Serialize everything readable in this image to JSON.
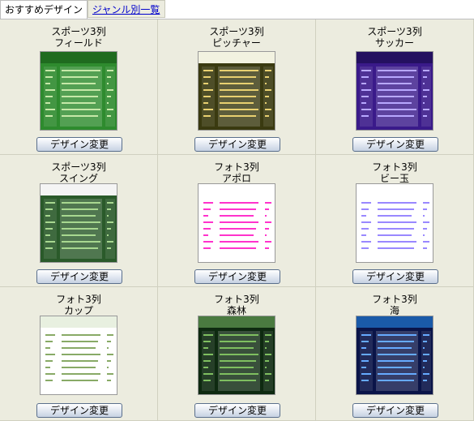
{
  "tabs": [
    {
      "label": "おすすめデザイン",
      "active": true
    },
    {
      "label": "ジャンル別一覧",
      "active": false
    }
  ],
  "button_label": "デザイン変更",
  "designs": [
    {
      "category": "スポーツ3列",
      "name": "フィールド",
      "theme": {
        "bg": "#2e8b2e",
        "header": "#1f6b1f",
        "accent": "#c6e8a8"
      }
    },
    {
      "category": "スポーツ3列",
      "name": "ピッチャー",
      "theme": {
        "bg": "#3a3a10",
        "header": "#f2f2e0",
        "accent": "#e8d070"
      }
    },
    {
      "category": "スポーツ3列",
      "name": "サッカー",
      "theme": {
        "bg": "#3a1a8a",
        "header": "#241060",
        "accent": "#b8a8ff"
      }
    },
    {
      "category": "スポーツ3列",
      "name": "スイング",
      "theme": {
        "bg": "#2a5a2a",
        "header": "#f4f4f4",
        "accent": "#a8d890"
      }
    },
    {
      "category": "フォト3列",
      "name": "アポロ",
      "theme": {
        "bg": "#ffffff",
        "header": "#ffffff",
        "accent": "#ff33cc"
      }
    },
    {
      "category": "フォト3列",
      "name": "ビー玉",
      "theme": {
        "bg": "#ffffff",
        "header": "#ffffff",
        "accent": "#9988ff"
      }
    },
    {
      "category": "フォト3列",
      "name": "カップ",
      "theme": {
        "bg": "#ffffff",
        "header": "#e8f0e0",
        "accent": "#88aa66"
      }
    },
    {
      "category": "フォト3列",
      "name": "森林",
      "theme": {
        "bg": "#0e2a10",
        "header": "#4a7a40",
        "accent": "#7fbf60"
      }
    },
    {
      "category": "フォト3列",
      "name": "海",
      "theme": {
        "bg": "#0a1448",
        "header": "#1a5aa8",
        "accent": "#66aaff"
      }
    }
  ]
}
